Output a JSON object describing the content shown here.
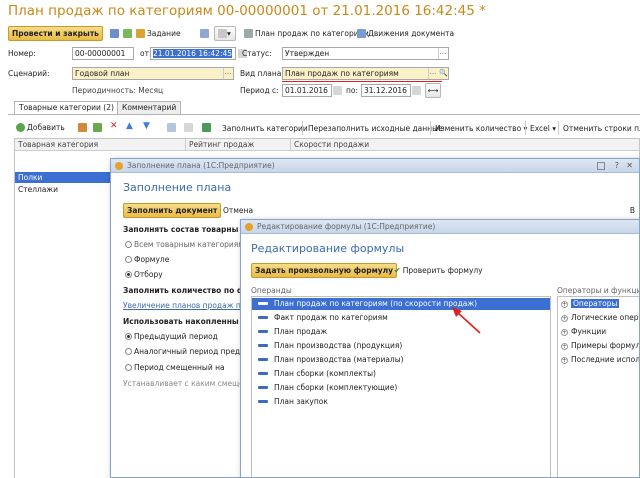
{
  "window": {
    "title": "План продаж по категориям 00-00000001 от 21.01.2016 16:42:45 *"
  },
  "toolbar": {
    "post_close": "Провести и закрыть",
    "task": "Задание",
    "print_plan": "План продаж по категориям",
    "doc_moves": "Движения документа"
  },
  "header": {
    "number_label": "Номер:",
    "number_value": "00-00000001",
    "from_label": "от:",
    "date_value": "21.01.2016 16:42:45",
    "status_label": "Статус:",
    "status_value": "Утвержден",
    "scenario_label": "Сценарий:",
    "scenario_value": "Годовой план",
    "plantype_label": "Вид плана:",
    "plantype_value": "План продаж по категориям",
    "periodicity": "Периодичность: Месяц",
    "period_label": "Период с:",
    "period_from": "01.01.2016",
    "period_to_label": "по:",
    "period_to": "31.12.2016"
  },
  "tabs": [
    "Товарные категории (2)",
    "Комментарий"
  ],
  "table_toolbar": {
    "add": "Добавить",
    "fill_categories": "Заполнить категории",
    "refill_source": "Перезаполнить исходные данные",
    "change_qty": "Изменить количество",
    "excel": "Excel",
    "cancel_rows": "Отменить строки плана"
  },
  "table": {
    "columns": [
      "Товарная категория",
      "Рейтинг продаж",
      "Скорости продажи"
    ],
    "rows": [
      "Полки",
      "Стеллажи"
    ]
  },
  "fill_dialog": {
    "window_title": "Заполнение плана (1С:Предприятие)",
    "heading": "Заполнение плана",
    "fill_doc": "Заполнить документ",
    "cancel": "Отмена",
    "compose_label": "Заполнять состав товарны",
    "opt_all": "Всем товарным категориям",
    "opt_formula": "Формуле",
    "opt_selection": "Отбору",
    "qty_label": "Заполнить количество по ф",
    "increase_link": "Увеличение планов продаж пр",
    "accum_label": "Использовать накопленны",
    "opt_prev": "Предыдущий период",
    "opt_similar": "Аналогичный период предыд",
    "opt_shifted": "Период смещенный на",
    "hint": "Устанавливает с каким смеще",
    "side_letter": "В"
  },
  "formula_dialog": {
    "window_title": "Редактирование формулы (1С:Предприятие)",
    "heading": "Редактирование формулы",
    "set_formula": "Задать произвольную формулу",
    "check_formula": "Проверить формулу",
    "operands_label": "Операнды",
    "operators_label": "Операторы и функции",
    "operands": [
      "План продаж по категориям (по скорости продаж)",
      "Факт продаж по категориям",
      "План продаж",
      "План производства (продукция)",
      "План производства (материалы)",
      "План сборки (комплекты)",
      "План сборки (комплектующие)",
      "План закупок"
    ],
    "operators": [
      "Операторы",
      "Логические опера",
      "Функции",
      "Примеры формул",
      "Последние испол"
    ]
  },
  "colors": {
    "accent": "#c8891a",
    "selection": "#3b6fd1",
    "arrow": "#e02020"
  }
}
